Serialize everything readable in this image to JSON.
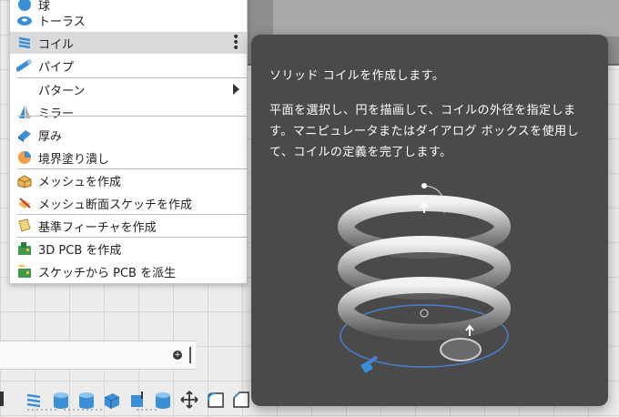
{
  "menu": {
    "items": [
      {
        "label": "球",
        "icon": "sphere-icon"
      },
      {
        "label": "トーラス",
        "icon": "torus-icon"
      },
      {
        "label": "コイル",
        "icon": "coil-icon"
      },
      {
        "label": "パイプ",
        "icon": "pipe-icon"
      },
      {
        "label": "パターン",
        "icon": ""
      },
      {
        "label": "ミラー",
        "icon": "mirror-icon"
      },
      {
        "label": "厚み",
        "icon": "thicken-icon"
      },
      {
        "label": "境界塗り潰し",
        "icon": "boundary-fill-icon"
      },
      {
        "label": "メッシュを作成",
        "icon": "create-mesh-icon"
      },
      {
        "label": "メッシュ断面スケッチを作成",
        "icon": "mesh-section-sketch-icon"
      },
      {
        "label": "基準フィーチャを作成",
        "icon": "base-feature-icon"
      },
      {
        "label": "3D PCB を作成",
        "icon": "3d-pcb-icon"
      },
      {
        "label": "スケッチから PCB を派生",
        "icon": "derive-pcb-icon"
      }
    ]
  },
  "tooltip": {
    "title": "ソリッド コイルを作成します。",
    "body": "平面を選択し、円を描画して、コイルの外径を指定します。マニピュレータまたはダイアログ ボックスを使用して、コイルの定義を完了します。"
  },
  "colors": {
    "tooltip_bg": "#4a4a4a",
    "menu_selected": "#dadada",
    "icon_blue": "#3a8fd6"
  }
}
